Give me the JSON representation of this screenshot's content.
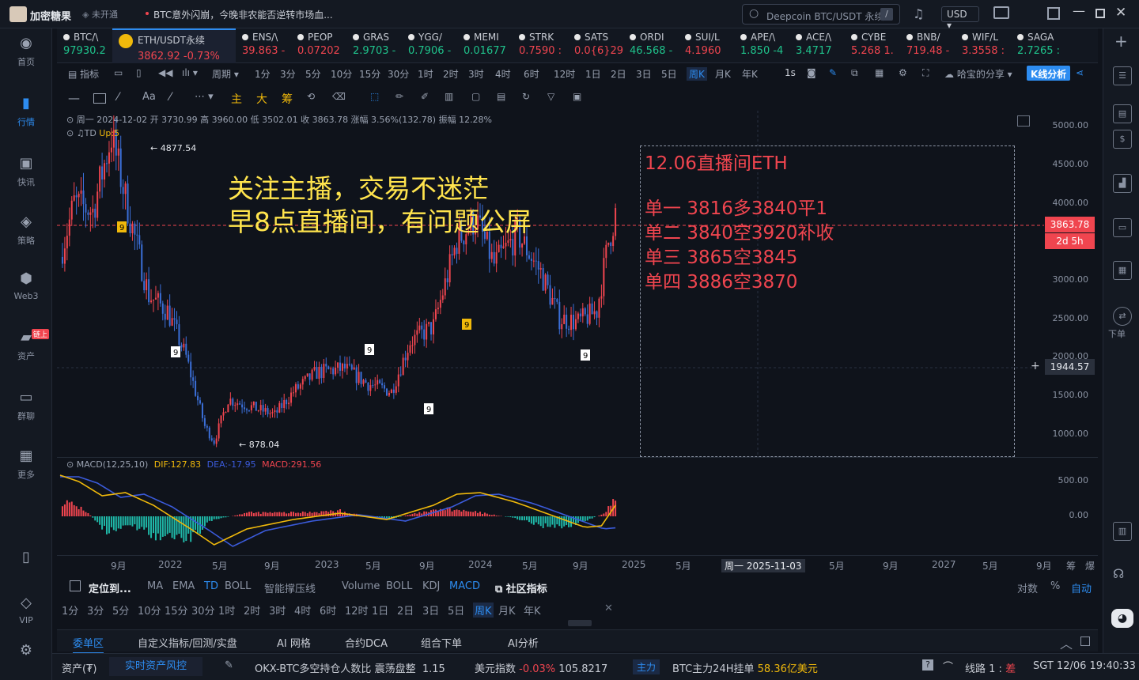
{
  "app": {
    "name": "加密糖果",
    "status": "未开通",
    "news": "BTC意外闪崩，今晚非农能否逆转市场血...",
    "search_placeholder": "Deepcoin BTC/USDT 永续",
    "search_key": "/",
    "currency": "USD"
  },
  "sidebar": [
    {
      "label": "首页",
      "icon": "home-icon"
    },
    {
      "label": "行情",
      "icon": "chart-bars-icon",
      "active": true
    },
    {
      "label": "快讯",
      "icon": "news-icon"
    },
    {
      "label": "策略",
      "icon": "robot-icon"
    },
    {
      "label": "Web3",
      "icon": "web3-icon"
    },
    {
      "label": "资产",
      "icon": "wallet-icon",
      "badge": "链上"
    },
    {
      "label": "群聊",
      "icon": "chat-icon"
    },
    {
      "label": "更多",
      "icon": "grid-icon"
    },
    {
      "label": "",
      "icon": "phone-icon"
    },
    {
      "label": "VIP",
      "icon": "diamond-icon"
    },
    {
      "label": "",
      "icon": "settings-icon"
    }
  ],
  "tickers": [
    {
      "name": "BTC/\\",
      "price": "97930.2",
      "dir": "up"
    },
    {
      "name": "ETH/USDT永续",
      "price": "3862.92  -0.73%",
      "dir": "dn",
      "active": true
    },
    {
      "name": "ENS/\\",
      "price": "39.863 -",
      "dir": "dn"
    },
    {
      "name": "PEOP",
      "price": "0.07202",
      "dir": "dn"
    },
    {
      "name": "GRAS",
      "price": "2.9703 -",
      "dir": "up"
    },
    {
      "name": "YGG/",
      "price": "0.7906 -",
      "dir": "up"
    },
    {
      "name": "MEMI",
      "price": "0.01677",
      "dir": "up"
    },
    {
      "name": "STRK",
      "price": "0.7590 :",
      "dir": "dn"
    },
    {
      "name": "SATS",
      "price": "0.0{6}29",
      "dir": "dn"
    },
    {
      "name": "ORDI",
      "price": "46.568 -",
      "dir": "up"
    },
    {
      "name": "SUI/L",
      "price": "4.1960",
      "dir": "dn"
    },
    {
      "name": "APE/\\",
      "price": "1.850 -4",
      "dir": "up"
    },
    {
      "name": "ACE/\\",
      "price": "3.4717",
      "dir": "up"
    },
    {
      "name": "CYBE",
      "price": "5.268 1.",
      "dir": "dn"
    },
    {
      "name": "BNB/",
      "price": "719.48 -",
      "dir": "dn"
    },
    {
      "name": "WIF/L",
      "price": "3.3558 :",
      "dir": "dn"
    },
    {
      "name": "SAGA",
      "price": "2.7265 :",
      "dir": "up"
    }
  ],
  "toolbar1": {
    "indicator": "指标",
    "period": "周期",
    "timeframes": [
      "1分",
      "3分",
      "5分",
      "10分",
      "15分",
      "30分",
      "1时",
      "2时",
      "3时",
      "4时",
      "6时",
      "12时",
      "1日",
      "2日",
      "3日",
      "5日",
      "周K",
      "月K",
      "年K"
    ],
    "selected": "周K",
    "tick": "1s",
    "share": "哈宝的分享",
    "kline": "K线分析"
  },
  "toolbar2": {
    "tags": [
      "主",
      "大",
      "筹"
    ]
  },
  "chart_info": {
    "ohlc": "周一 2024-12-02 开 3730.99 高 3960.00 低 3502.01 收 3863.78 涨幅 3.56%(132.78) 振幅 12.28%",
    "td": "TD",
    "td_val": "Up:5",
    "high_label": "4877.54",
    "low_label": "878.04",
    "price_tag": "3863.78",
    "countdown": "2d 5h",
    "crosshair": "1944.57",
    "yticks": [
      "5000.00",
      "4500.00",
      "4000.00",
      "3500.00",
      "3000.00",
      "2500.00",
      "2000.00",
      "1500.00",
      "1000.00"
    ],
    "overlay1": "关注主播，交易不迷茫",
    "overlay2": "早8点直播间，有问题公屏",
    "note_title": "12.06直播间ETH",
    "notes": [
      "单一 3816多3840平1",
      "单二 3840空3920补收",
      "单三 3865空3845",
      "单四 3886空3870"
    ],
    "td_marks": [
      "9",
      "9",
      "9",
      "9",
      "9",
      "9"
    ]
  },
  "macd": {
    "label": "MACD(12,25,10)",
    "dif": "DIF:127.83",
    "dea": "DEA:-17.95",
    "macd": "MACD:291.56",
    "yticks": [
      "500.00",
      "0.00"
    ]
  },
  "xaxis": {
    "labels": [
      "9月",
      "2022",
      "5月",
      "9月",
      "2023",
      "5月",
      "9月",
      "2024",
      "5月",
      "9月",
      "2025",
      "5月",
      "周一 2025-11-03",
      "5月",
      "9月",
      "2027",
      "5月",
      "9月"
    ],
    "right": [
      "筹",
      "爆"
    ]
  },
  "ind_bar": {
    "locate": "定位到...",
    "items": [
      "MA",
      "EMA",
      "TD",
      "BOLL",
      "智能撑压线",
      "Volume",
      "BOLL",
      "KDJ",
      "MACD"
    ],
    "community": "社区指标",
    "right": [
      "对数",
      "%",
      "自动"
    ]
  },
  "tf_bar2": [
    "1分",
    "3分",
    "5分",
    "10分",
    "15分",
    "30分",
    "1时",
    "2时",
    "3时",
    "4时",
    "6时",
    "12时",
    "1日",
    "2日",
    "3日",
    "5日",
    "周K",
    "月K",
    "年K"
  ],
  "bottom_tabs": [
    "委单区",
    "自定义指标/回测/实盘",
    "AI 网格",
    "合约DCA",
    "组合下单",
    "AI分析"
  ],
  "status": {
    "asset": "资产(₮)",
    "risk": "实时资产风控",
    "okx": "OKX-BTC多空持仓人数比",
    "okx_state": "震荡盘整",
    "okx_val": "1.15",
    "usd_index": "美元指数",
    "usd_change": "-0.03%",
    "usd_val": "105.8217",
    "main": "主力",
    "btc_main": "BTC主力24H挂单",
    "btc_val": "58.36亿美元",
    "line": "线路 1 :",
    "line_state": "差",
    "time": "SGT 12/06 19:40:33"
  },
  "colors": {
    "accent": "#2d8cf0",
    "up": "#1fc28b",
    "down": "#f0454f",
    "yellow": "#ffe44d",
    "note": "#f0454f"
  },
  "chart_data": {
    "type": "candlestick-weekly",
    "symbol": "ETH/USDT永续",
    "ylim": [
      700,
      5200
    ],
    "keypoints": [
      {
        "t": 0,
        "v": 3300
      },
      {
        "t": 6,
        "v": 4000
      },
      {
        "t": 14,
        "v": 3900
      },
      {
        "t": 22,
        "v": 4877
      },
      {
        "t": 30,
        "v": 3800
      },
      {
        "t": 38,
        "v": 2800
      },
      {
        "t": 46,
        "v": 2600
      },
      {
        "t": 54,
        "v": 2000
      },
      {
        "t": 62,
        "v": 1100
      },
      {
        "t": 66,
        "v": 900
      },
      {
        "t": 72,
        "v": 1450
      },
      {
        "t": 82,
        "v": 1350
      },
      {
        "t": 92,
        "v": 1250
      },
      {
        "t": 100,
        "v": 1550
      },
      {
        "t": 110,
        "v": 1800
      },
      {
        "t": 122,
        "v": 1850
      },
      {
        "t": 132,
        "v": 1650
      },
      {
        "t": 142,
        "v": 1550
      },
      {
        "t": 150,
        "v": 2200
      },
      {
        "t": 160,
        "v": 2400
      },
      {
        "t": 170,
        "v": 3500
      },
      {
        "t": 178,
        "v": 3800
      },
      {
        "t": 186,
        "v": 3200
      },
      {
        "t": 196,
        "v": 3600
      },
      {
        "t": 206,
        "v": 3100
      },
      {
        "t": 214,
        "v": 2500
      },
      {
        "t": 222,
        "v": 2450
      },
      {
        "t": 230,
        "v": 2600
      },
      {
        "t": 235,
        "v": 3500
      },
      {
        "t": 238,
        "v": 3864
      }
    ]
  }
}
